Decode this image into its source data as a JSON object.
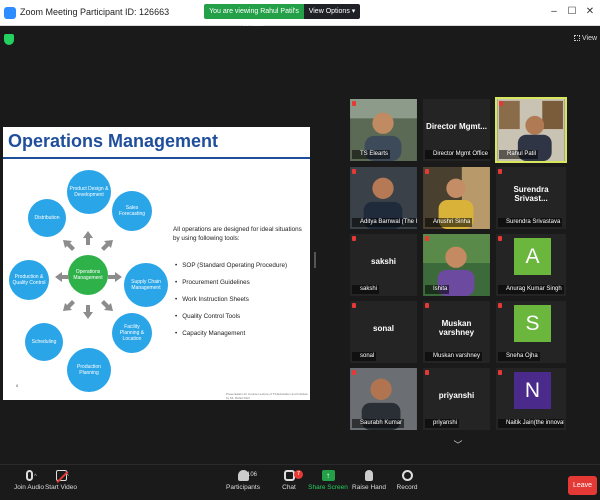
{
  "window": {
    "title": "Zoom Meeting Participant ID: 126663"
  },
  "banner": {
    "viewing": "You are viewing Rahul Patil's screen",
    "view_options": "View Options ▾"
  },
  "stage": {
    "view_label": "View"
  },
  "slide": {
    "title": "Operations Management",
    "center_node": "Operations Management",
    "nodes": [
      "Product Design & Development",
      "Sales Forecasting",
      "Supply Chain Management",
      "Facility Planning & Location",
      "Production Planning",
      "Scheduling",
      "Production & Quality Control",
      "Distribution"
    ],
    "intro": "All operations are designed for ideal situations by using following tools:",
    "tools": [
      "SOP (Standard Operating Procedure)",
      "Procurement Guidelines",
      "Work Instruction Sheets",
      "Quality Control Tools",
      "Capacity Management"
    ],
    "footer": "Presentation for Course Lecture of TS Education and Institute by Mr. Rahul Patil",
    "page_number": "8"
  },
  "participants": [
    {
      "name": "TS Elearts",
      "display": "",
      "type": "video"
    },
    {
      "name": "Director Mgmt Office IT...",
      "display": "Director  Mgmt...",
      "type": "name"
    },
    {
      "name": "Rahul Patil",
      "display": "",
      "type": "video",
      "active": true
    },
    {
      "name": "Aditya Barnwal (The I...",
      "display": "",
      "type": "video"
    },
    {
      "name": "Anushri Sinha",
      "display": "",
      "type": "video"
    },
    {
      "name": "Surendra Srivastava",
      "display": "Surendra  Srivast...",
      "type": "name"
    },
    {
      "name": "sakshi",
      "display": "sakshi",
      "type": "name"
    },
    {
      "name": "Ishita",
      "display": "",
      "type": "video"
    },
    {
      "name": "Anurag Kumar Singh",
      "display": "A",
      "type": "avatar",
      "color": "#6bb73e"
    },
    {
      "name": "sonal",
      "display": "sonal",
      "type": "name"
    },
    {
      "name": "Muskan varshney",
      "display": "Muskan  varshney",
      "type": "name"
    },
    {
      "name": "Sneha Ojha",
      "display": "S",
      "type": "avatar",
      "color": "#6bb73e"
    },
    {
      "name": "Saurabh Kumar",
      "display": "",
      "type": "video"
    },
    {
      "name": "priyanshi",
      "display": "priyanshi",
      "type": "name"
    },
    {
      "name": "Naitik Jain(the innovat...",
      "display": "N",
      "type": "avatar",
      "color": "#4a2b8c"
    }
  ],
  "toolbar": {
    "join_audio": "Join Audio",
    "start_video": "Start Video",
    "participants": "Participants",
    "participants_count": "106",
    "chat": "Chat",
    "chat_badge": "7",
    "share_screen": "Share Screen",
    "raise_hand": "Raise Hand",
    "record": "Record",
    "leave": "Leave"
  }
}
